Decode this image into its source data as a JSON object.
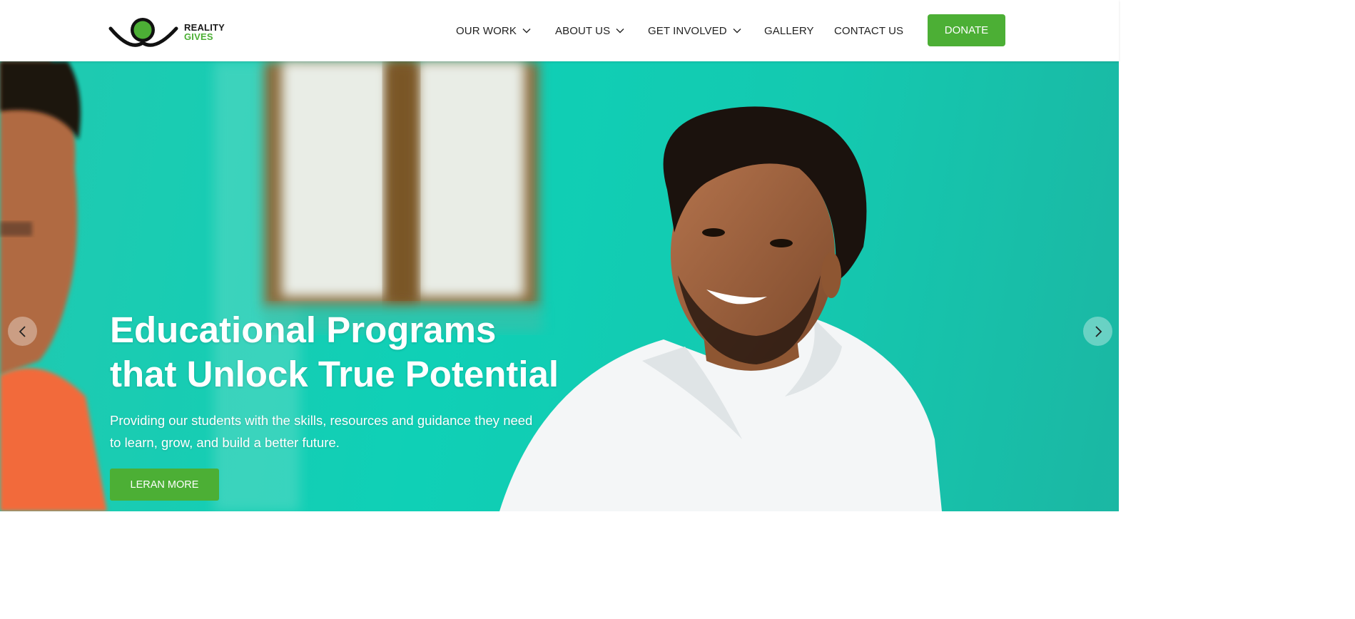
{
  "brand": {
    "name_line1": "REALITY",
    "name_line2": "GIVES",
    "accent_color": "#4caf35"
  },
  "nav": {
    "items": [
      {
        "label": "OUR WORK",
        "has_dropdown": true
      },
      {
        "label": "ABOUT US",
        "has_dropdown": true
      },
      {
        "label": "GET INVOLVED",
        "has_dropdown": true
      },
      {
        "label": "GALLERY",
        "has_dropdown": false
      },
      {
        "label": "CONTACT US",
        "has_dropdown": false
      }
    ],
    "donate_label": "DONATE"
  },
  "hero": {
    "title_line1": "Educational Programs",
    "title_line2": "that Unlock True Potential",
    "subtitle": "Providing our students with the skills, resources and guidance they need to learn, grow, and build a better future.",
    "cta_label": "LERAN MORE",
    "prev_icon": "chevron-left-icon",
    "next_icon": "chevron-right-icon",
    "background_color": "#14c9b0"
  }
}
